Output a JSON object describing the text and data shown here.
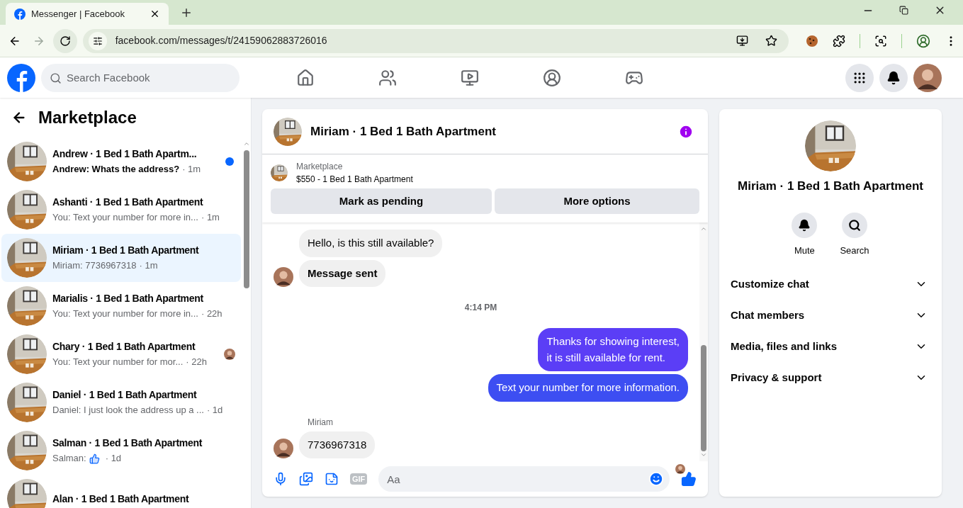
{
  "browser": {
    "tab_title": "Messenger | Facebook",
    "url": "facebook.com/messages/t/24159062883726016"
  },
  "header": {
    "search": {
      "placeholder": "Search Facebook"
    }
  },
  "sidebar": {
    "title": "Marketplace",
    "conversations": [
      {
        "name": "Andrew · 1 Bed 1 Bath Apartm...",
        "preview": "Andrew: Whats the address?",
        "time": "· 1m",
        "unread": true,
        "selected": false,
        "seen": false
      },
      {
        "name": "Ashanti · 1 Bed 1 Bath Apartment",
        "preview": "You: Text your number for more in...",
        "time": "· 1m",
        "unread": false,
        "selected": false,
        "seen": false
      },
      {
        "name": "Miriam · 1 Bed 1 Bath Apartment",
        "preview": "Miriam: 7736967318",
        "time": "· 1m",
        "unread": false,
        "selected": true,
        "seen": false
      },
      {
        "name": "Marialis · 1 Bed 1 Bath Apartment",
        "preview": "You: Text your number for more in...",
        "time": "· 22h",
        "unread": false,
        "selected": false,
        "seen": false
      },
      {
        "name": "Chary · 1 Bed 1 Bath Apartment",
        "preview": "You: Text your number for mor...",
        "time": "· 22h",
        "unread": false,
        "selected": false,
        "seen": true
      },
      {
        "name": "Daniel · 1 Bed 1 Bath Apartment",
        "preview": "Daniel: I just look the address up a ...",
        "time": "· 1d",
        "unread": false,
        "selected": false,
        "seen": false
      },
      {
        "name": "Salman · 1 Bed 1 Bath Apartment",
        "preview": "Salman:",
        "like_icon": true,
        "time": "· 1d",
        "unread": false,
        "selected": false,
        "seen": false
      },
      {
        "name": "Alan · 1 Bed 1 Bath Apartment",
        "selected": false
      }
    ]
  },
  "chat": {
    "title": "Miriam · 1 Bed 1 Bath Apartment",
    "listing": {
      "label": "Marketplace",
      "detail": "$550 - 1 Bed 1 Bath Apartment",
      "buttons": [
        "Mark as pending",
        "More options"
      ]
    },
    "messages": [
      {
        "kind": "incoming",
        "text": "Hello, is this still available?",
        "bold": false,
        "avatar": false
      },
      {
        "kind": "incoming",
        "text": "Message sent",
        "bold": true,
        "avatar": true
      },
      {
        "kind": "time",
        "text": "4:14 PM"
      },
      {
        "kind": "outgoing",
        "text": "Thanks for showing interest,\nit is still available for rent.",
        "color": "#5b3ef6"
      },
      {
        "kind": "outgoing",
        "text": "Text your number for more information.",
        "color": "#3d4ef2"
      },
      {
        "kind": "sender",
        "text": "Miriam"
      },
      {
        "kind": "incoming",
        "text": "7736967318",
        "bold": false,
        "avatar": true
      }
    ],
    "composer": {
      "gif_label": "GIF",
      "placeholder": "Aa"
    }
  },
  "details": {
    "title": "Miriam · 1 Bed 1 Bath Apartment",
    "actions": [
      {
        "kind": "mute",
        "label": "Mute"
      },
      {
        "kind": "search",
        "label": "Search"
      }
    ],
    "sections": [
      {
        "label": "Customize chat",
        "expanded": false
      },
      {
        "label": "Chat members",
        "expanded": false
      },
      {
        "label": "Media, files and links",
        "expanded": false
      },
      {
        "label": "Privacy & support",
        "expanded": false
      }
    ]
  }
}
